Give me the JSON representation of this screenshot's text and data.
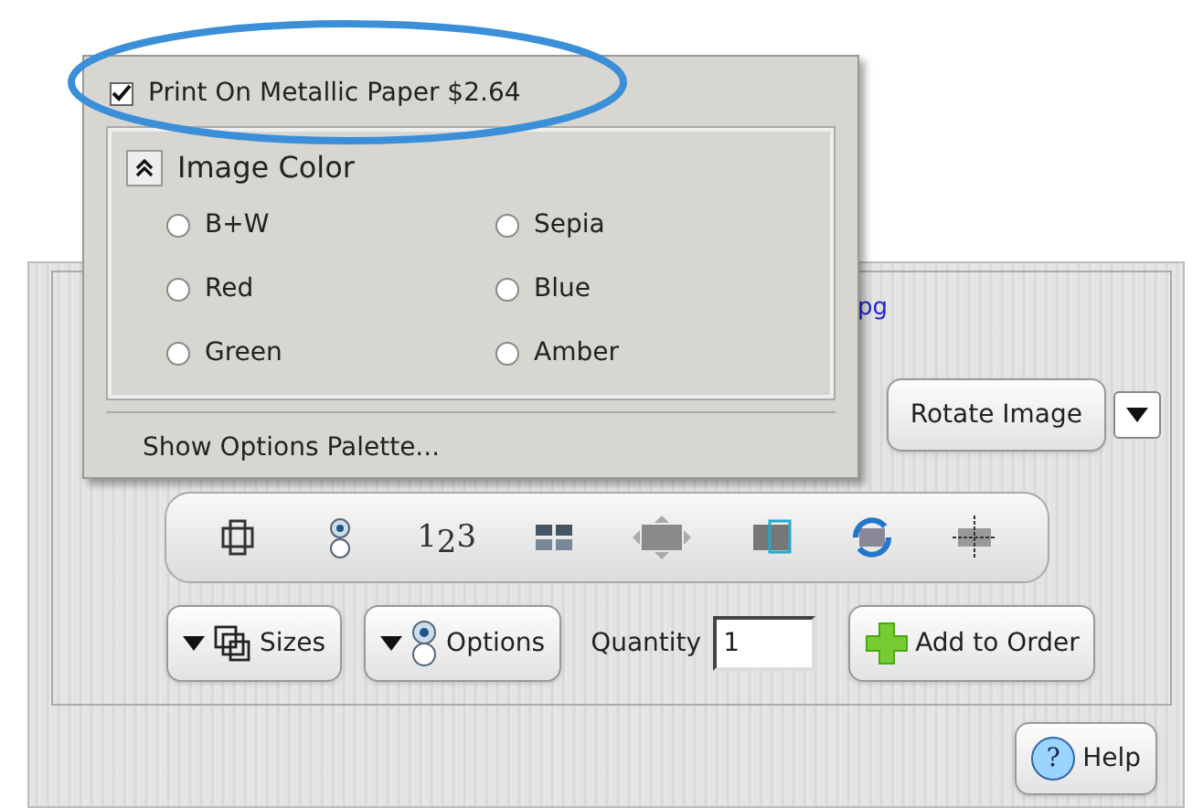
{
  "options_menu": {
    "metallic_paper": {
      "label": "Print On Metallic Paper $2.64",
      "checked": true
    },
    "image_color": {
      "title": "Image Color",
      "expanded": true,
      "options": [
        {
          "label": "B+W",
          "selected": false
        },
        {
          "label": "Sepia",
          "selected": false
        },
        {
          "label": "Red",
          "selected": false
        },
        {
          "label": "Blue",
          "selected": false
        },
        {
          "label": "Green",
          "selected": false
        },
        {
          "label": "Amber",
          "selected": false
        }
      ]
    },
    "show_palette": "Show Options Palette..."
  },
  "panel": {
    "link_fragment": "pg",
    "numbering_digits": [
      "1",
      "2",
      "3"
    ],
    "help_glyph": "?",
    "rotate_button": "Rotate Image",
    "sizes_button": "Sizes",
    "options_button": "Options",
    "quantity": {
      "label": "Quantity",
      "value": "1"
    },
    "add_button": "Add to Order",
    "help_button": "Help"
  }
}
